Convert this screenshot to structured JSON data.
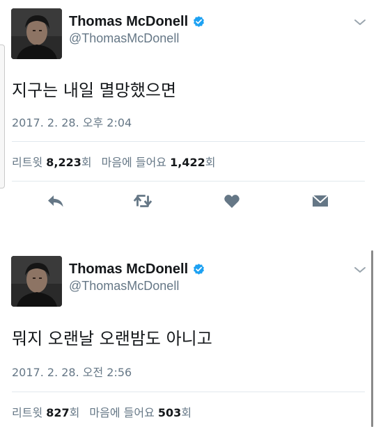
{
  "tweets": [
    {
      "display_name": "Thomas McDonell",
      "handle": "@ThomasMcDonell",
      "text": "지구는 내일 멸망했으면",
      "timestamp": "2017. 2. 28. 오후 2:04",
      "retweets_label": "리트윗",
      "retweets_count": "8,223",
      "count_suffix": "회",
      "likes_label": "마음에 들어요",
      "likes_count": "1,422"
    },
    {
      "display_name": "Thomas McDonell",
      "handle": "@ThomasMcDonell",
      "text": "뭐지 오랜날 오랜밤도 아니고",
      "timestamp": "2017. 2. 28. 오전 2:56",
      "retweets_label": "리트윗",
      "retweets_count": "827",
      "count_suffix": "회",
      "likes_label": "마음에 들어요",
      "likes_count": "503"
    }
  ],
  "icons": {
    "verified": "verified-badge-icon",
    "menu": "chevron-down-icon",
    "reply": "reply-icon",
    "retweet": "retweet-icon",
    "like": "heart-icon",
    "dm": "direct-message-icon"
  },
  "colors": {
    "verified": "#1da1f2",
    "secondary_text": "#657786",
    "primary_text": "#14171a",
    "action_icon": "#657786",
    "divider": "#e1e8ed"
  }
}
